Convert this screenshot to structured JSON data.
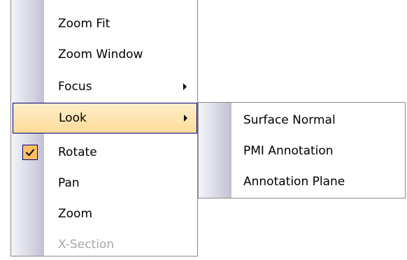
{
  "context_menu": {
    "items": [
      {
        "label": "Zoom Fit"
      },
      {
        "label": "Zoom Window"
      },
      {
        "label": "Focus",
        "has_submenu": true
      },
      {
        "label": "Look",
        "has_submenu": true,
        "highlighted": true
      },
      {
        "label": "Rotate",
        "checked": true
      },
      {
        "label": "Pan"
      },
      {
        "label": "Zoom"
      },
      {
        "label": "X-Section",
        "disabled": true
      }
    ]
  },
  "look_submenu": {
    "items": [
      {
        "label": "Surface Normal"
      },
      {
        "label": "PMI Annotation"
      },
      {
        "label": "Annotation Plane"
      }
    ]
  },
  "icons": {
    "checkmark": "checkmark-icon",
    "submenu_arrow": "submenu-arrow-icon"
  },
  "colors": {
    "highlight_top": "#ffeecb",
    "highlight_bottom": "#fddc98",
    "highlight_border": "#000080",
    "check_background": "#ffc064",
    "disabled_text": "#a8a8a8",
    "menu_border": "#8a8a8a"
  }
}
